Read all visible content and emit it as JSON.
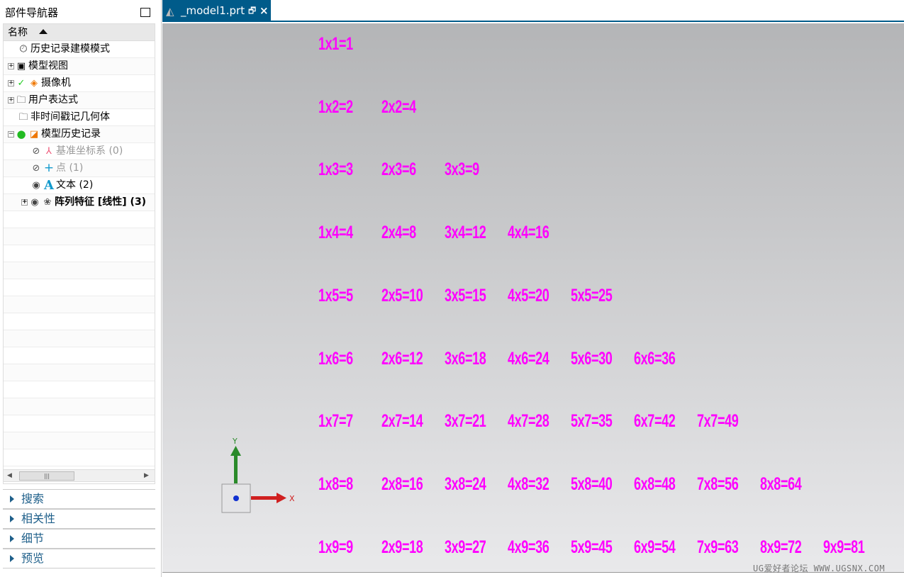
{
  "navigator": {
    "title": "部件导航器",
    "column_header": "名称",
    "items": [
      {
        "label": "历史记录建模模式",
        "icon": "clock-icon"
      },
      {
        "label": "模型视图",
        "icon": "model-view-icon",
        "expand": "+"
      },
      {
        "label": "摄像机",
        "icon": "camera-icon",
        "expand": "+",
        "check": "✓"
      },
      {
        "label": "用户表达式",
        "icon": "folder-icon",
        "expand": "+"
      },
      {
        "label": "非时间戳记几何体",
        "icon": "folder-icon"
      },
      {
        "label": "模型历史记录",
        "icon": "history-icon",
        "expand": "−"
      },
      {
        "label": "基准坐标系 (0)",
        "icon": "datum-csys-icon"
      },
      {
        "label": "点 (1)",
        "icon": "point-icon"
      },
      {
        "label": "文本 (2)",
        "icon": "text-icon"
      },
      {
        "label": "阵列特征 [线性] (3)",
        "icon": "pattern-icon",
        "expand": "+"
      }
    ],
    "sections": [
      "搜索",
      "相关性",
      "细节",
      "预览"
    ]
  },
  "tab": {
    "label": "_model1.prt"
  },
  "axes": {
    "x": "X",
    "y": "Y"
  },
  "watermark": "UG爱好者论坛 WWW.UGSNX.COM",
  "colors": {
    "text": "#ff00ff",
    "accent": "#005b8a"
  },
  "table": [
    [
      "1x1=1"
    ],
    [
      "1x2=2",
      "2x2=4"
    ],
    [
      "1x3=3",
      "2x3=6",
      "3x3=9"
    ],
    [
      "1x4=4",
      "2x4=8",
      "3x4=12",
      "4x4=16"
    ],
    [
      "1x5=5",
      "2x5=10",
      "3x5=15",
      "4x5=20",
      "5x5=25"
    ],
    [
      "1x6=6",
      "2x6=12",
      "3x6=18",
      "4x6=24",
      "5x6=30",
      "6x6=36"
    ],
    [
      "1x7=7",
      "2x7=14",
      "3x7=21",
      "4x7=28",
      "5x7=35",
      "6x7=42",
      "7x7=49"
    ],
    [
      "1x8=8",
      "2x8=16",
      "3x8=24",
      "4x8=32",
      "5x8=40",
      "6x8=48",
      "7x8=56",
      "8x8=64"
    ],
    [
      "1x9=9",
      "2x9=18",
      "3x9=27",
      "4x9=36",
      "5x9=45",
      "6x9=54",
      "7x9=63",
      "8x9=72",
      "9x9=81"
    ]
  ]
}
